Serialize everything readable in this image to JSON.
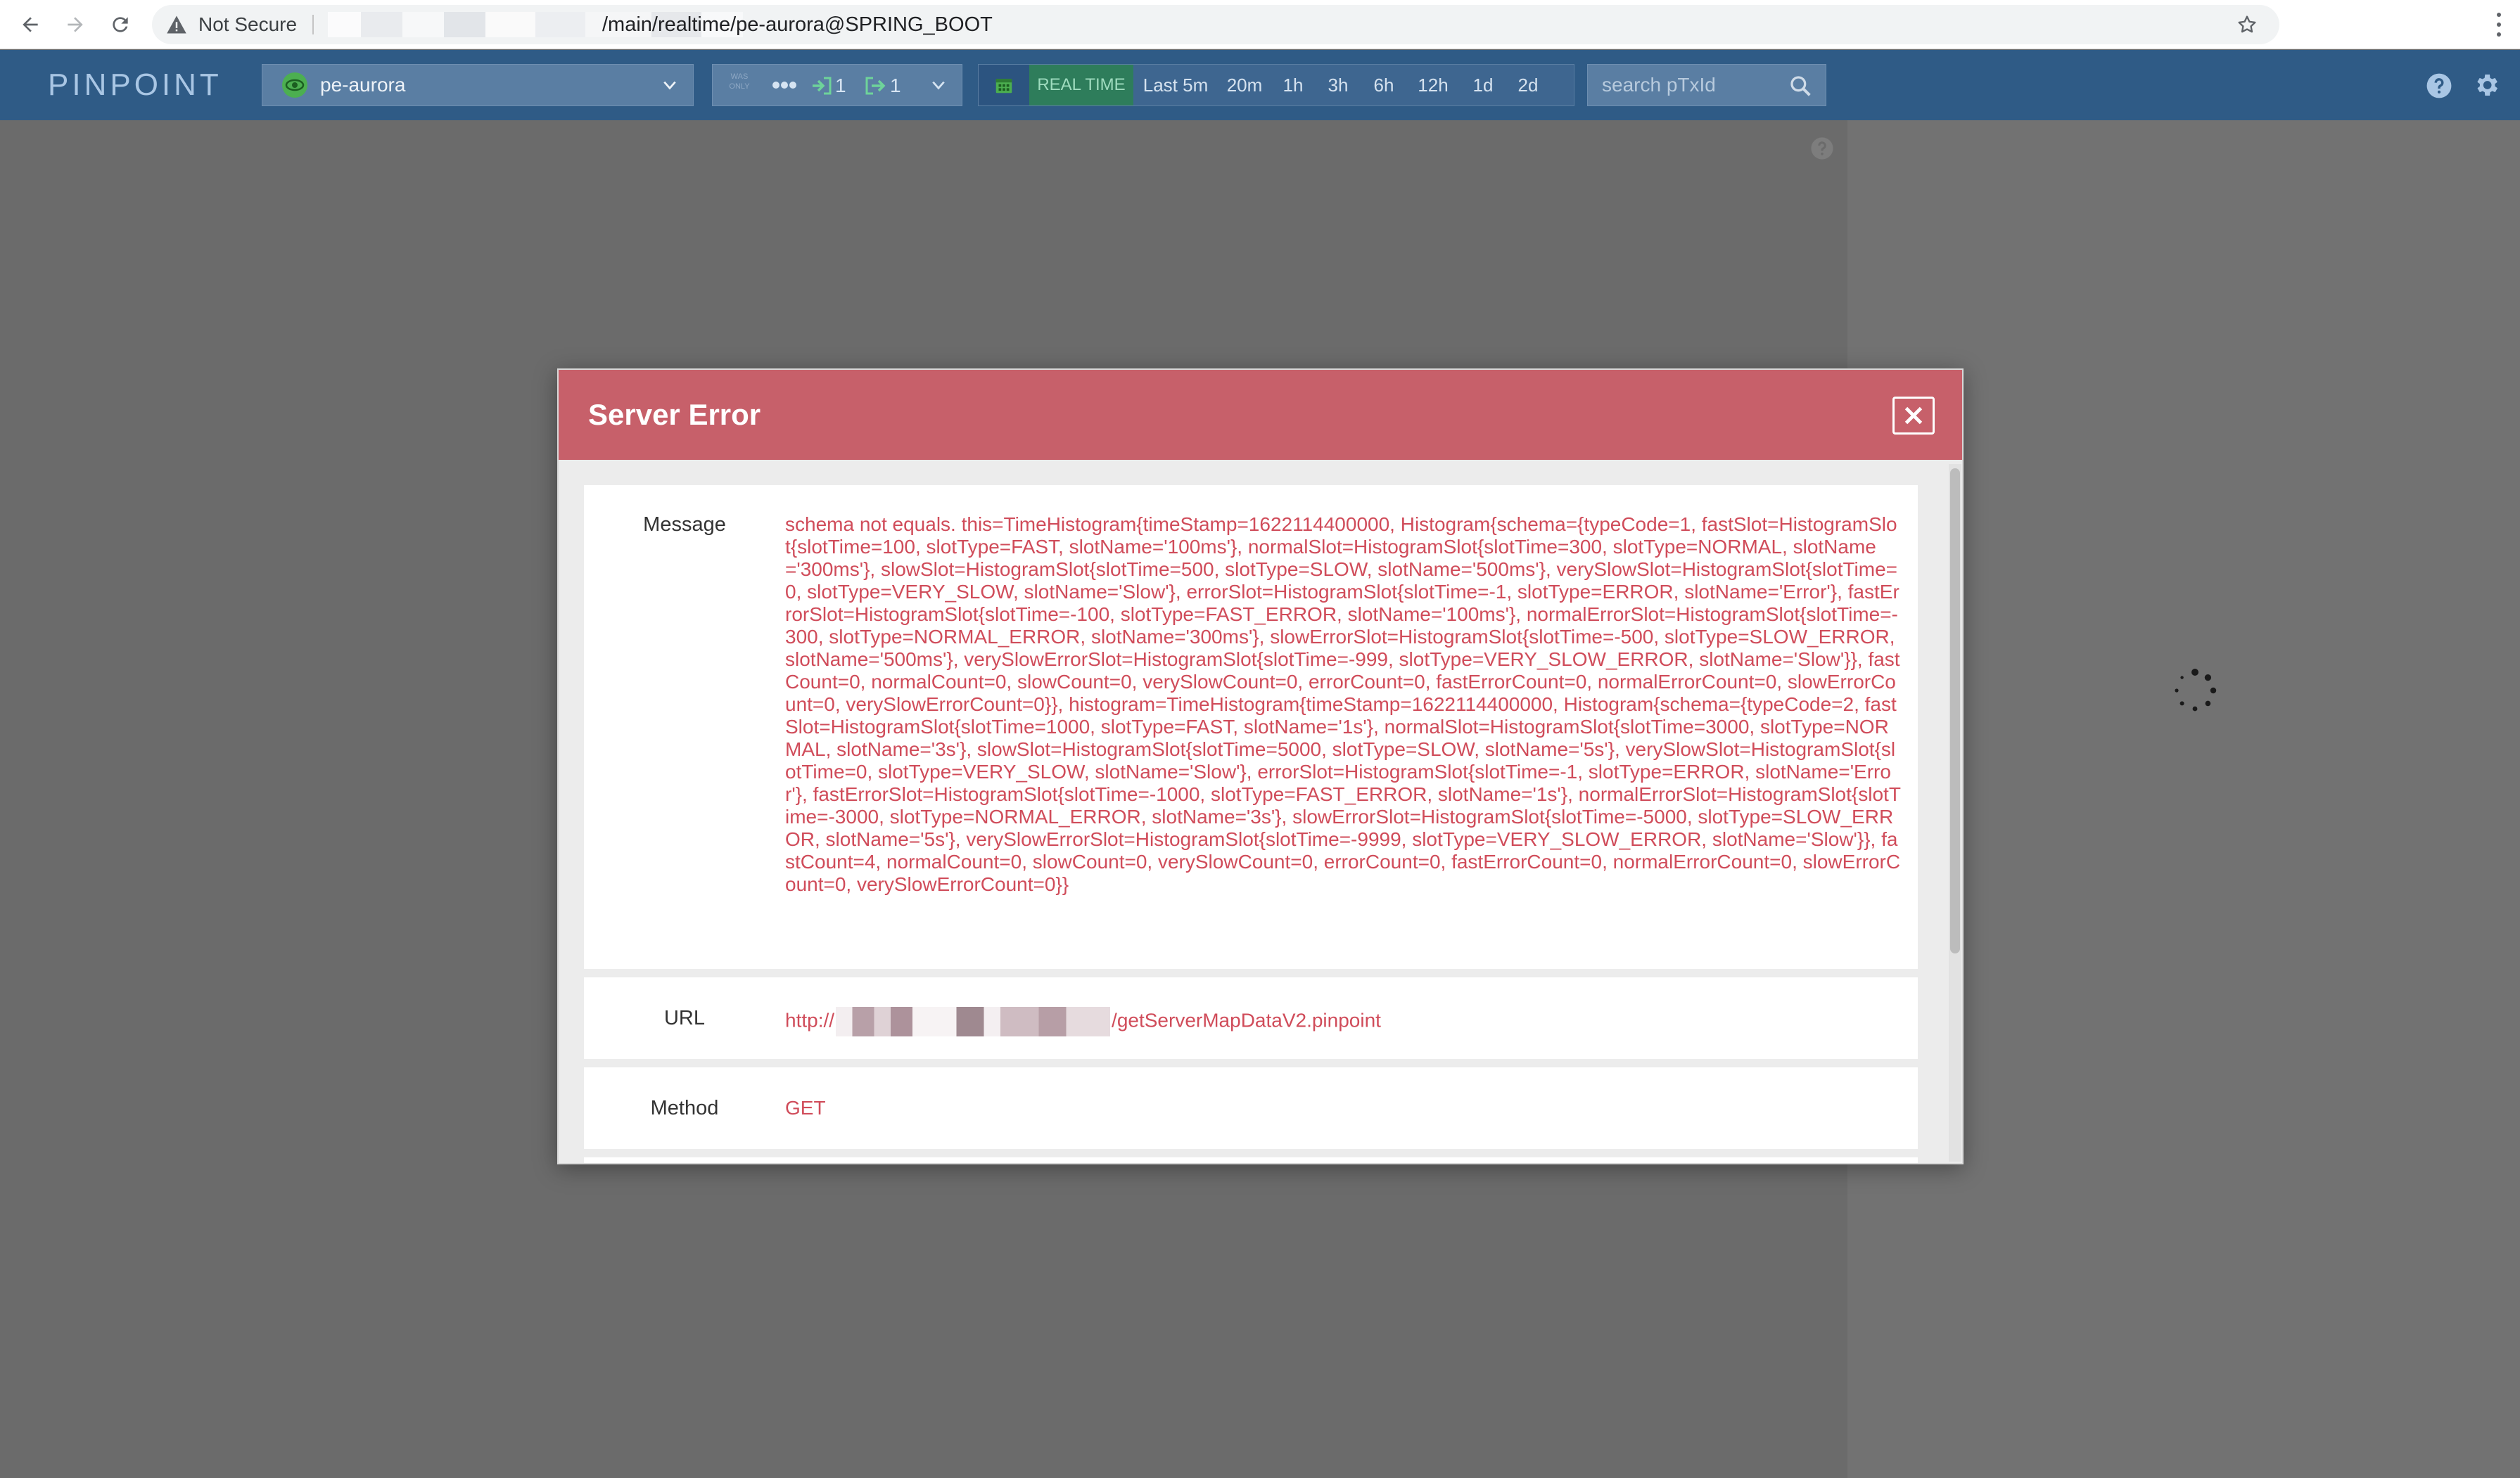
{
  "browser": {
    "security_label": "Not Secure",
    "url_path": "/main/realtime/pe-aurora@SPRING_BOOT"
  },
  "header": {
    "logo": "PINPOINT",
    "application": "pe-aurora",
    "server_mode_label": "WAS ONLY",
    "inbound_count": "1",
    "outbound_count": "1",
    "time": {
      "realtime_label": "REAL TIME",
      "options": [
        "Last 5m",
        "20m",
        "1h",
        "3h",
        "6h",
        "12h",
        "1d",
        "2d"
      ]
    },
    "search_placeholder": "search pTxId"
  },
  "colors": {
    "header_bg": "#2f5b86",
    "modal_header_bg": "#c7606a",
    "error_text": "#d04c5a",
    "realtime_bg": "#2e7d5b"
  },
  "icons": {
    "back": "arrow-left-icon",
    "forward": "arrow-right-icon",
    "reload": "reload-icon",
    "security": "warning-triangle-icon",
    "bookmark": "star-icon",
    "menu": "kebab-menu-icon",
    "app": "eye-icon",
    "calendar": "calendar-icon",
    "search": "search-icon",
    "help": "question-circle-icon",
    "settings": "gear-icon",
    "close": "close-icon",
    "loading": "spinner-icon"
  },
  "modal": {
    "title": "Server Error",
    "rows": {
      "message": {
        "label": "Message",
        "value": "schema not equals. this=TimeHistogram{timeStamp=1622114400000, Histogram{schema={typeCode=1, fastSlot=HistogramSlot{slotTime=100, slotType=FAST, slotName='100ms'}, normalSlot=HistogramSlot{slotTime=300, slotType=NORMAL, slotName='300ms'}, slowSlot=HistogramSlot{slotTime=500, slotType=SLOW, slotName='500ms'}, verySlowSlot=HistogramSlot{slotTime=0, slotType=VERY_SLOW, slotName='Slow'}, errorSlot=HistogramSlot{slotTime=-1, slotType=ERROR, slotName='Error'}, fastErrorSlot=HistogramSlot{slotTime=-100, slotType=FAST_ERROR, slotName='100ms'}, normalErrorSlot=HistogramSlot{slotTime=-300, slotType=NORMAL_ERROR, slotName='300ms'}, slowErrorSlot=HistogramSlot{slotTime=-500, slotType=SLOW_ERROR, slotName='500ms'}, verySlowErrorSlot=HistogramSlot{slotTime=-999, slotType=VERY_SLOW_ERROR, slotName='Slow'}}, fastCount=0, normalCount=0, slowCount=0, verySlowCount=0, errorCount=0, fastErrorCount=0, normalErrorCount=0, slowErrorCount=0, verySlowErrorCount=0}}, histogram=TimeHistogram{timeStamp=1622114400000, Histogram{schema={typeCode=2, fastSlot=HistogramSlot{slotTime=1000, slotType=FAST, slotName='1s'}, normalSlot=HistogramSlot{slotTime=3000, slotType=NORMAL, slotName='3s'}, slowSlot=HistogramSlot{slotTime=5000, slotType=SLOW, slotName='5s'}, verySlowSlot=HistogramSlot{slotTime=0, slotType=VERY_SLOW, slotName='Slow'}, errorSlot=HistogramSlot{slotTime=-1, slotType=ERROR, slotName='Error'}, fastErrorSlot=HistogramSlot{slotTime=-1000, slotType=FAST_ERROR, slotName='1s'}, normalErrorSlot=HistogramSlot{slotTime=-3000, slotType=NORMAL_ERROR, slotName='3s'}, slowErrorSlot=HistogramSlot{slotTime=-5000, slotType=SLOW_ERROR, slotName='5s'}, verySlowErrorSlot=HistogramSlot{slotTime=-9999, slotType=VERY_SLOW_ERROR, slotName='Slow'}}, fastCount=4, normalCount=0, slowCount=0, verySlowCount=0, errorCount=0, fastErrorCount=0, normalErrorCount=0, slowErrorCount=0, verySlowErrorCount=0}}"
      },
      "url": {
        "label": "URL",
        "prefix": "http://",
        "suffix": "/getServerMapDataV2.pinpoint"
      },
      "method": {
        "label": "Method",
        "value": "GET"
      }
    }
  }
}
